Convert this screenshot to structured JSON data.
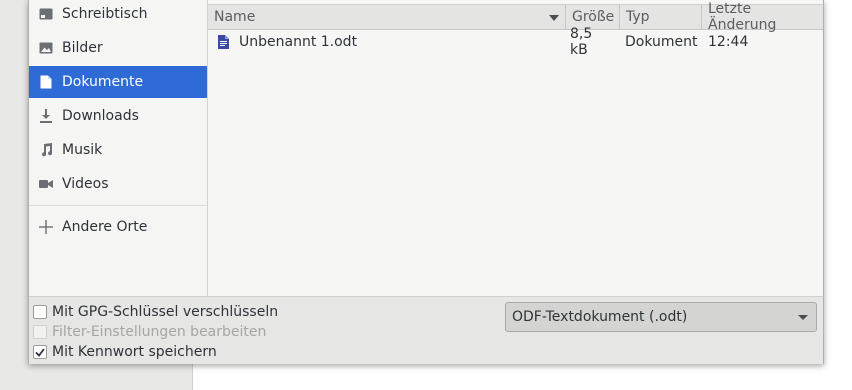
{
  "sidebar": {
    "items": [
      {
        "label": "Schreibtisch",
        "icon": "desktop-icon"
      },
      {
        "label": "Bilder",
        "icon": "pictures-icon"
      },
      {
        "label": "Dokumente",
        "icon": "document-icon",
        "active": true
      },
      {
        "label": "Downloads",
        "icon": "download-icon"
      },
      {
        "label": "Musik",
        "icon": "music-icon"
      },
      {
        "label": "Videos",
        "icon": "video-icon"
      },
      {
        "label": "Andere Orte",
        "icon": "plus-icon"
      }
    ]
  },
  "file_list": {
    "columns": {
      "name": "Name",
      "size": "Größe",
      "type": "Typ",
      "modified": "Letzte Änderung"
    },
    "rows": [
      {
        "name": "Unbenannt 1.odt",
        "size": "8,5 kB",
        "type": "Dokument",
        "modified": "12:44",
        "icon": "odt-document-icon"
      }
    ]
  },
  "options": {
    "gpg_label": "Mit GPG-Schlüssel verschlüsseln",
    "gpg_checked": false,
    "filter_label": "Filter-Einstellungen bearbeiten",
    "filter_checked": false,
    "filter_enabled": false,
    "password_label": "Mit Kennwort speichern",
    "password_checked": true
  },
  "file_type": {
    "selected": "ODF-Textdokument (.odt)"
  },
  "colors": {
    "accent": "#2f6bd6",
    "doc_icon": "#3b4aa8"
  }
}
